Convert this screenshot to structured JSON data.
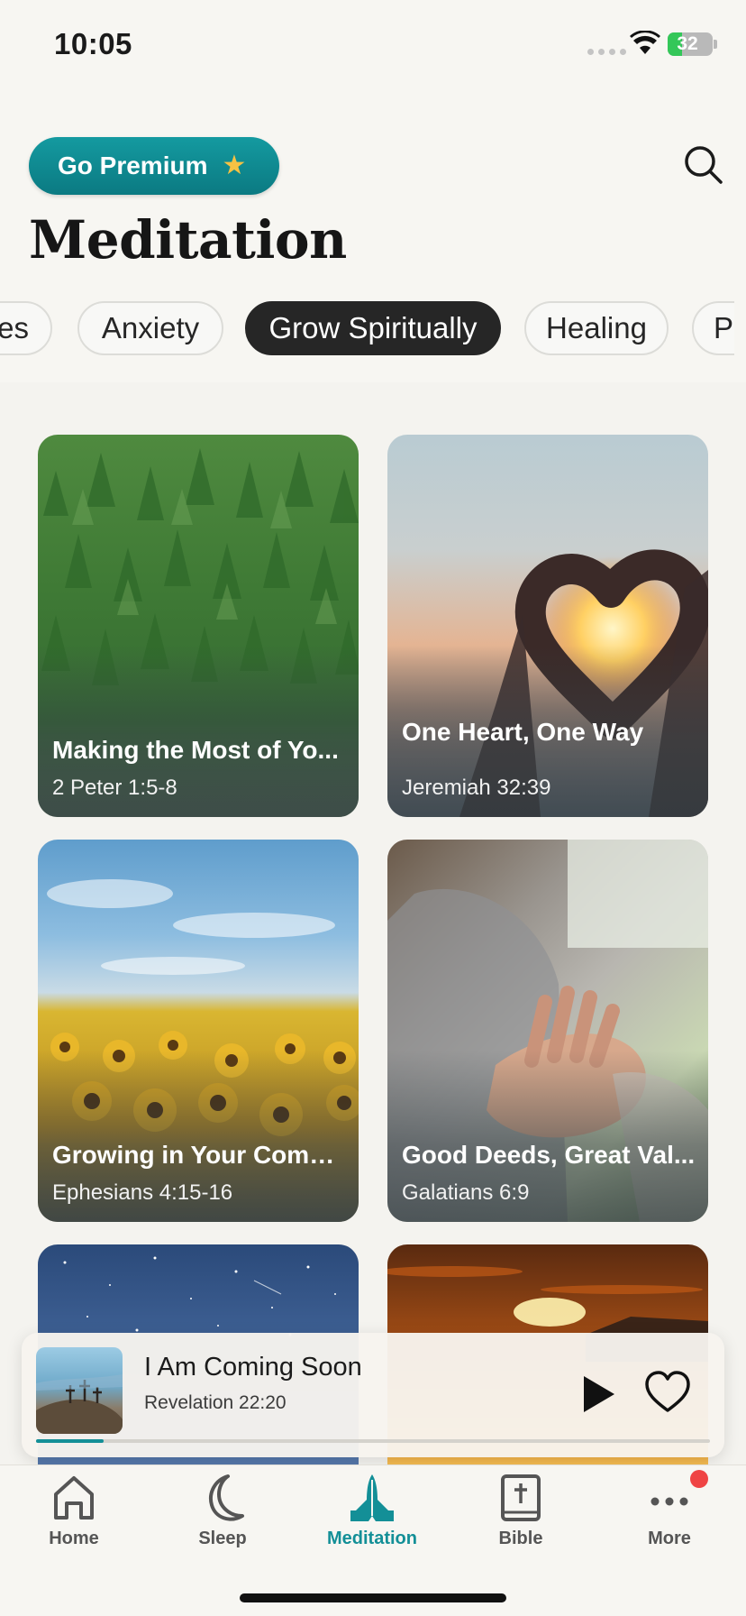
{
  "status_bar": {
    "time": "10:05",
    "battery_level": "32",
    "battery_fraction": 0.32
  },
  "header": {
    "premium_label": "Go Premium",
    "premium_icon": "star-icon",
    "title": "Meditation",
    "search_icon": "search-icon"
  },
  "chips": [
    {
      "label": "es",
      "active": false
    },
    {
      "label": "Anxiety",
      "active": false
    },
    {
      "label": "Grow Spiritually",
      "active": true
    },
    {
      "label": "Healing",
      "active": false
    },
    {
      "label": "Pe",
      "active": false
    }
  ],
  "cards": [
    {
      "title": "Making the Most of Yo...",
      "verse": "2 Peter 1:5-8",
      "image": "pine-forest-image"
    },
    {
      "title": "One Heart, One Way",
      "verse": "Jeremiah 32:39",
      "image": "heart-hands-sunset-image"
    },
    {
      "title": "Growing in Your Comm...",
      "verse": "Ephesians 4:15-16",
      "image": "sunflower-field-image"
    },
    {
      "title": "Good Deeds, Great Val...",
      "verse": "Galatians 6:9",
      "image": "holding-hands-image"
    },
    {
      "title": "",
      "verse": "",
      "image": "starry-night-image"
    },
    {
      "title": "",
      "verse": "",
      "image": "orange-sunset-image"
    }
  ],
  "now_playing": {
    "title": "I Am Coming Soon",
    "verse": "Revelation 22:20",
    "image": "crosses-on-hill-image",
    "progress": 0.1
  },
  "tabs": [
    {
      "label": "Home",
      "icon": "home-icon",
      "active": false
    },
    {
      "label": "Sleep",
      "icon": "moon-icon",
      "active": false
    },
    {
      "label": "Meditation",
      "icon": "praying-hands-icon",
      "active": true
    },
    {
      "label": "Bible",
      "icon": "bible-icon",
      "active": false
    },
    {
      "label": "More",
      "icon": "more-dots-icon",
      "active": false,
      "badge": true
    }
  ]
}
